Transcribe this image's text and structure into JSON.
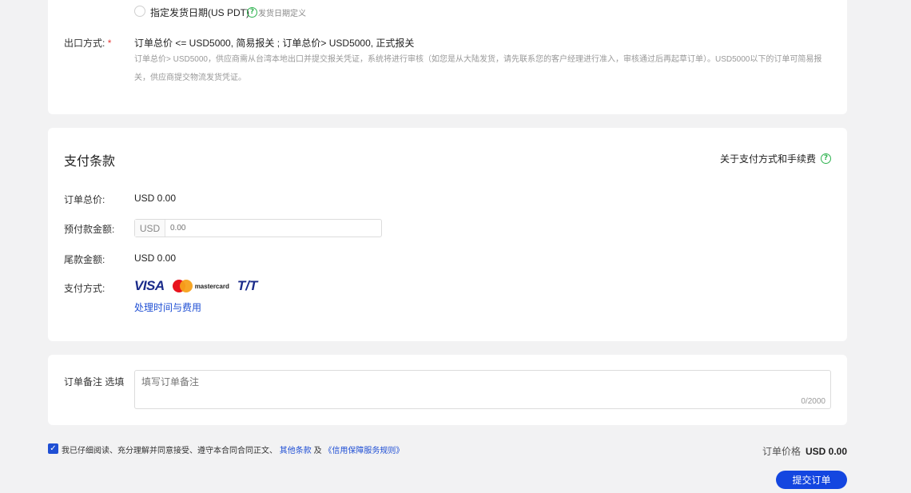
{
  "shipping": {
    "option_label": "指定发货日期(US PDT)",
    "help_text": "发货日期定义"
  },
  "export": {
    "label": "出口方式:",
    "required_mark": "*",
    "value": "订单总价 <= USD5000, 简易报关 ; 订单总价> USD5000, 正式报关",
    "desc_line1": "订单总价> USD5000，供应商需从台湾本地出口并提交报关凭证，系统将进行审核（如您是从大陆发货，请先联系您的客户经理进行准入，审核通过后再起草订单）。USD5000以下的订单可简易报",
    "desc_line2": "关，供应商提交物流发货凭证。"
  },
  "payment": {
    "title": "支付条款",
    "help_link": "关于支付方式和手续费",
    "total_label": "订单总价:",
    "total_value": "USD 0.00",
    "prepay_label": "预付款金额:",
    "prepay_prefix": "USD",
    "prepay_placeholder": "0.00",
    "balance_label": "尾款金额:",
    "balance_value": "USD 0.00",
    "method_label": "支付方式:",
    "methods": {
      "visa": "VISA",
      "mastercard": "mastercard",
      "tt": "T/T"
    },
    "fees_link": "处理时间与费用"
  },
  "remarks": {
    "label": "订单备注 选填",
    "placeholder": "填写订单备注",
    "counter": "0/2000"
  },
  "footer": {
    "agree_text": "我已仔细阅读、充分理解并同意接受、遵守本合同合同正文、",
    "link1": "其他条款",
    "and": "及",
    "link2": "《信用保障服务规则》",
    "price_label": "订单价格",
    "price_value": "USD 0.00",
    "submit_label": "提交订单"
  },
  "colors": {
    "accent": "#1446e0",
    "link": "#1f4fd4",
    "help_green": "#2fb350",
    "required": "#e53935"
  }
}
